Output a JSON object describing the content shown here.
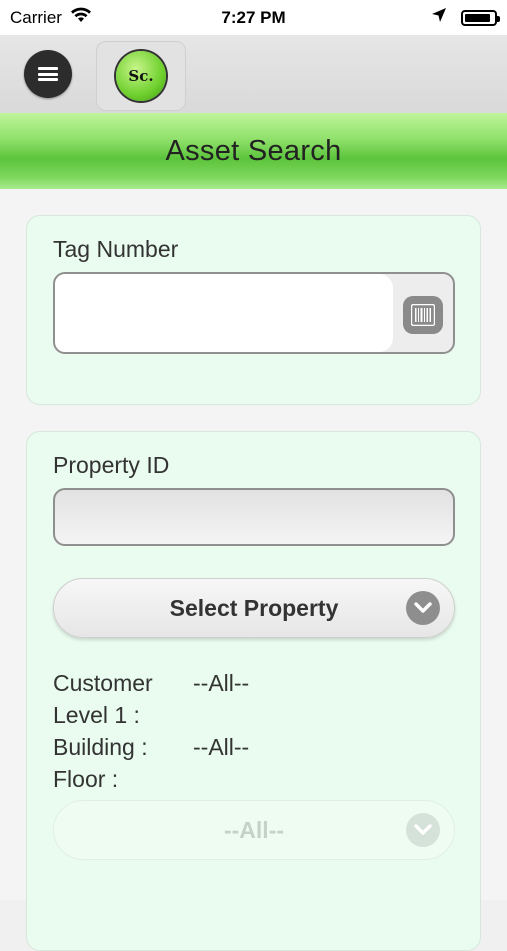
{
  "status_bar": {
    "carrier": "Carrier",
    "time": "7:27 PM",
    "battery_level": 0.9
  },
  "toolbar": {
    "menu_icon": "hamburger-menu-icon",
    "logo_text": "Sc."
  },
  "header": {
    "title": "Asset Search"
  },
  "tag_section": {
    "label": "Tag Number",
    "value": "",
    "scan_icon": "barcode-icon"
  },
  "property_section": {
    "label": "Property ID",
    "value": "",
    "select_label": "Select Property",
    "rows": [
      {
        "label": "Customer",
        "value": "--All--"
      },
      {
        "label": "Level 1 :",
        "value": ""
      },
      {
        "label": "Building :",
        "value": "--All--"
      },
      {
        "label": "Floor :",
        "value": ""
      }
    ],
    "floor_select": "--All--"
  },
  "colors": {
    "header_green": "#7ed75c",
    "card_bg": "#e9fcef",
    "menu_dark": "#2c2c2c"
  }
}
